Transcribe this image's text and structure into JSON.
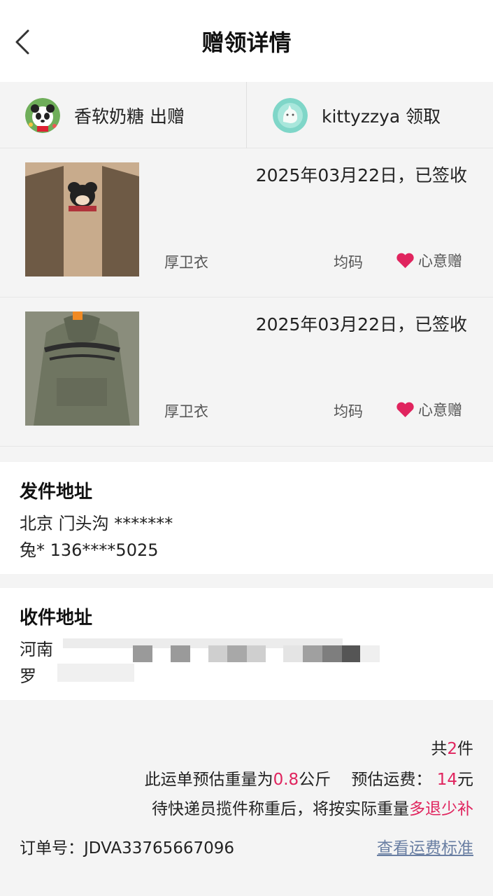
{
  "header": {
    "title": "赠领详情"
  },
  "giver": {
    "name": "香软奶糖",
    "action": "出赠"
  },
  "receiver": {
    "name": "kittyzzya",
    "action": "领取"
  },
  "items": [
    {
      "date": "2025年03月22日，已签收",
      "name": "厚卫衣",
      "size": "均码",
      "tag": "心意赠"
    },
    {
      "date": "2025年03月22日，已签收",
      "name": "厚卫衣",
      "size": "均码",
      "tag": "心意赠"
    }
  ],
  "sender": {
    "title": "发件地址",
    "address": "北京 门头沟 *******",
    "contact": "兔* 136****5025"
  },
  "recipient": {
    "title": "收件地址",
    "address_prefix": "河南",
    "name_prefix": "罗"
  },
  "summary": {
    "count_prefix": "共",
    "count": "2",
    "count_suffix": "件",
    "weight_prefix": "此运单预估重量为",
    "weight": "0.8",
    "weight_unit": "公斤",
    "fee_label": "预估运费：",
    "fee": "14",
    "fee_unit": "元",
    "note_prefix": "待快递员揽件称重后，将按实际重量",
    "note_highlight": "多退少补"
  },
  "order": {
    "label": "订单号：",
    "number": "JDVA33765667096"
  },
  "link": {
    "label": "查看运费标准"
  },
  "colors": {
    "accent": "#e0245e",
    "link": "#6a7fa3",
    "background": "#f4f4f4"
  }
}
